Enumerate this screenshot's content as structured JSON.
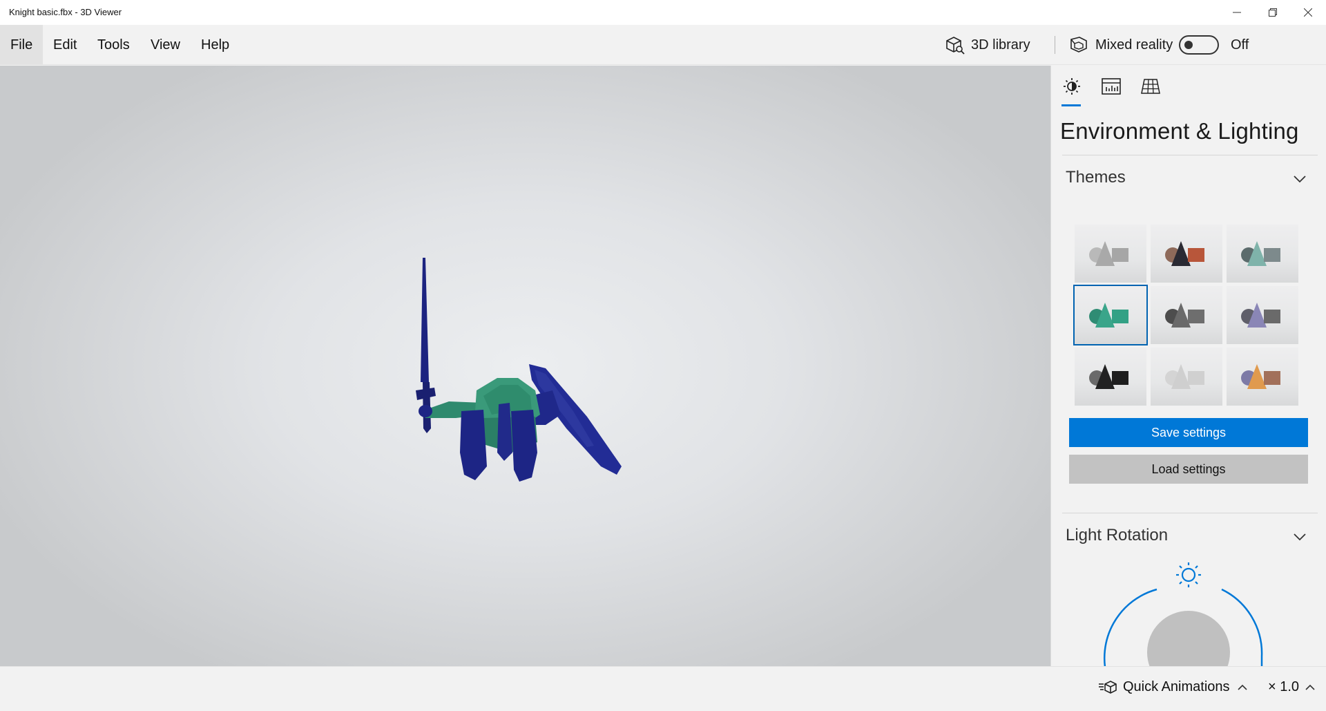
{
  "window": {
    "title": "Knight basic.fbx - 3D Viewer",
    "controls": [
      "minimize-icon",
      "restore-icon",
      "close-icon"
    ]
  },
  "menu": {
    "items": [
      "File",
      "Edit",
      "Tools",
      "View",
      "Help"
    ],
    "active": "File",
    "library_label": "3D library",
    "mixed_reality_label": "Mixed reality",
    "toggle_state": "Off"
  },
  "panel": {
    "tabs": [
      "sun-icon",
      "stats-icon",
      "grid-icon"
    ],
    "title": "Environment & Lighting",
    "themes_title": "Themes",
    "theme_count": 9,
    "selected_theme_index": 3,
    "save_label": "Save settings",
    "load_label": "Load settings",
    "light_rotation_title": "Light Rotation"
  },
  "bottom": {
    "quick_animations_label": "Quick Animations",
    "speed_label": "× 1.0"
  },
  "colors": {
    "accent": "#0078d7",
    "model_armor": "#1f2a8c",
    "model_body": "#3a9a7a"
  }
}
